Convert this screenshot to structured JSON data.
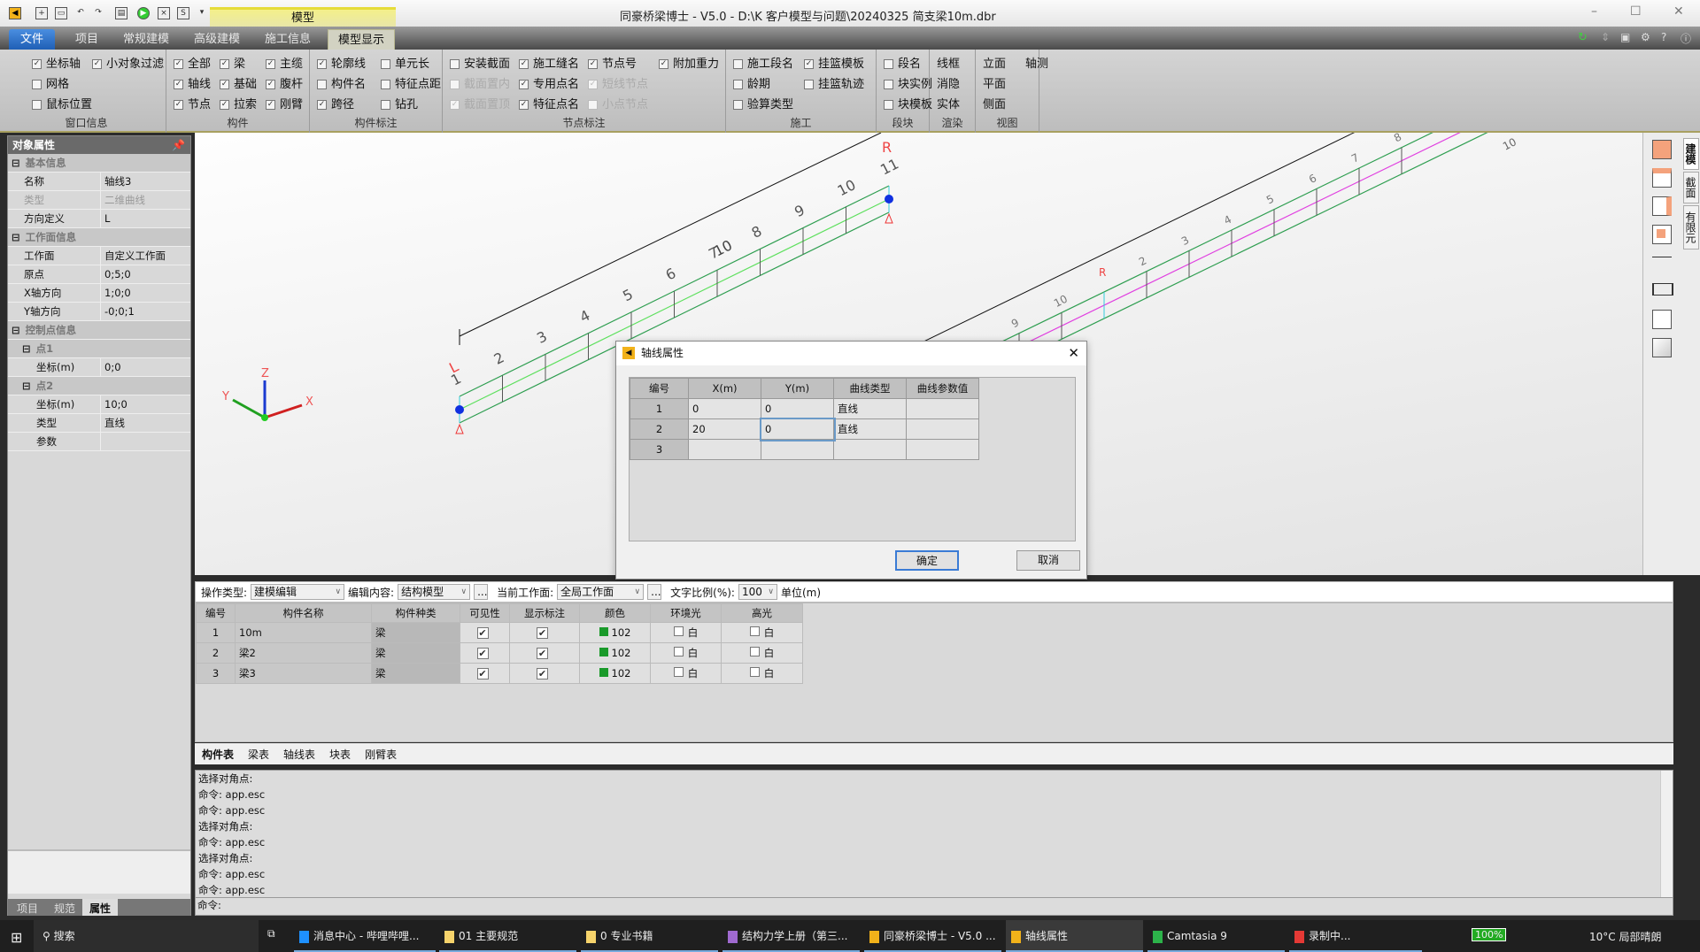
{
  "titlebar": {
    "title": "同豪桥梁博士 - V5.0 - D:\\K 客户模型与问题\\20240325 简支梁10m.dbr",
    "context_tab": "模型"
  },
  "tabs": [
    "文件",
    "项目",
    "常规建模",
    "高级建模",
    "施工信息",
    "模型显示"
  ],
  "ribbon": [
    {
      "label": "窗口信息",
      "cols": [
        [
          {
            "t": "坐标轴",
            "c": true
          },
          {
            "t": "网格",
            "c": false
          },
          {
            "t": "鼠标位置",
            "c": false
          }
        ],
        [
          {
            "t": "小对象过滤",
            "c": true
          }
        ]
      ]
    },
    {
      "label": "构件",
      "cols": [
        [
          {
            "t": "全部",
            "c": true
          },
          {
            "t": "轴线",
            "c": true
          },
          {
            "t": "节点",
            "c": true
          }
        ],
        [
          {
            "t": "梁",
            "c": true
          },
          {
            "t": "基础",
            "c": true
          },
          {
            "t": "拉索",
            "c": true
          }
        ],
        [
          {
            "t": "主缆",
            "c": true
          },
          {
            "t": "腹杆",
            "c": true
          },
          {
            "t": "刚臂",
            "c": true
          }
        ]
      ]
    },
    {
      "label": "构件标注",
      "cols": [
        [
          {
            "t": "轮廓线",
            "c": true
          },
          {
            "t": "构件名",
            "c": false
          },
          {
            "t": "跨径",
            "c": true
          }
        ],
        [
          {
            "t": "单元长",
            "c": false
          },
          {
            "t": "特征点距",
            "c": false
          },
          {
            "t": "钻孔",
            "c": false
          }
        ]
      ]
    },
    {
      "label": "节点标注",
      "cols": [
        [
          {
            "t": "安装截面",
            "c": false
          },
          {
            "t": "截面置内",
            "c": false,
            "d": true
          },
          {
            "t": "截面置顶",
            "c": true,
            "d": true
          }
        ],
        [
          {
            "t": "施工缝名",
            "c": true
          },
          {
            "t": "专用点名",
            "c": true
          },
          {
            "t": "特征点名",
            "c": true
          }
        ],
        [
          {
            "t": "节点号",
            "c": true
          },
          {
            "t": "短线节点",
            "c": true,
            "d": true
          },
          {
            "t": "小点节点",
            "c": false,
            "d": true
          }
        ],
        [
          {
            "t": "附加重力",
            "c": true
          }
        ]
      ]
    },
    {
      "label": "施工",
      "cols": [
        [
          {
            "t": "施工段名",
            "c": false
          },
          {
            "t": "龄期",
            "c": false
          },
          {
            "t": "验算类型",
            "c": false
          }
        ],
        [
          {
            "t": "挂篮模板",
            "c": true
          },
          {
            "t": "挂篮轨迹",
            "c": false
          }
        ]
      ]
    },
    {
      "label": "段块",
      "cols": [
        [
          {
            "t": "段名",
            "c": false
          },
          {
            "t": "块实例",
            "c": false
          },
          {
            "t": "块模板",
            "c": false
          }
        ]
      ]
    },
    {
      "label": "渲染",
      "cols": [
        [
          {
            "t": "线框"
          },
          {
            "t": "消隐"
          },
          {
            "t": "实体"
          }
        ]
      ]
    },
    {
      "label": "视图",
      "cols": [
        [
          {
            "t": "立面"
          },
          {
            "t": "平面"
          },
          {
            "t": "侧面"
          }
        ],
        [
          {
            "t": "轴测"
          }
        ]
      ]
    }
  ],
  "props": {
    "title": "对象属性",
    "rows": [
      {
        "k": "基本信息",
        "type": "sec"
      },
      {
        "k": "名称",
        "v": "轴线3"
      },
      {
        "k": "类型",
        "v": "二维曲线",
        "type": "dim"
      },
      {
        "k": "方向定义",
        "v": "L"
      },
      {
        "k": "工作面信息",
        "type": "sec"
      },
      {
        "k": "工作面",
        "v": "自定义工作面"
      },
      {
        "k": "原点",
        "v": "0;5;0"
      },
      {
        "k": "X轴方向",
        "v": "1;0;0"
      },
      {
        "k": "Y轴方向",
        "v": "-0;0;1"
      },
      {
        "k": "控制点信息",
        "type": "sec"
      },
      {
        "k": "点1",
        "type": "subsec"
      },
      {
        "k": "坐标(m)",
        "v": "0;0",
        "type": "sub"
      },
      {
        "k": "点2",
        "type": "subsec"
      },
      {
        "k": "坐标(m)",
        "v": "10;0",
        "type": "sub"
      },
      {
        "k": "类型",
        "v": "直线",
        "type": "sub"
      },
      {
        "k": "参数",
        "v": "",
        "type": "sub"
      }
    ],
    "bottom_tabs": [
      "项目",
      "规范",
      "属性"
    ]
  },
  "viewport": {
    "left_labels": [
      "1",
      "2",
      "3",
      "4",
      "5",
      "6",
      "7",
      "8",
      "9",
      "10",
      "11"
    ],
    "dim_label": "10",
    "L": "L",
    "R": "R",
    "right_labels": [
      "9",
      "10",
      "2",
      "3",
      "4",
      "5",
      "6",
      "7",
      "8"
    ],
    "right_dim_label": "10",
    "axes": [
      "X",
      "Y",
      "Z"
    ]
  },
  "right_tabs": [
    "建模",
    "截面",
    "有限元"
  ],
  "dialog": {
    "title": "轴线属性",
    "headers": [
      "编号",
      "X(m)",
      "Y(m)",
      "曲线类型",
      "曲线参数值"
    ],
    "rows": [
      [
        "1",
        "0",
        "0",
        "直线",
        ""
      ],
      [
        "2",
        "20",
        "0",
        "直线",
        ""
      ],
      [
        "3",
        "",
        "",
        "",
        ""
      ]
    ],
    "ok": "确定",
    "cancel": "取消"
  },
  "toolbar": {
    "op_label": "操作类型:",
    "op_value": "建模编辑",
    "content_label": "编辑内容:",
    "content_value": "结构模型",
    "plane_label": "当前工作面:",
    "plane_value": "全局工作面",
    "scale_label": "文字比例(%):",
    "scale_value": "100",
    "unit": "单位(m)",
    "more": "..."
  },
  "components": {
    "headers": [
      "编号",
      "构件名称",
      "构件种类",
      "可见性",
      "显示标注",
      "颜色",
      "环境光",
      "高光"
    ],
    "rows": [
      {
        "id": "1",
        "name": "10m",
        "kind": "梁",
        "visible": true,
        "label": true,
        "color": "102",
        "ambient": "白",
        "specular": "白"
      },
      {
        "id": "2",
        "name": "梁2",
        "kind": "梁",
        "visible": true,
        "label": true,
        "color": "102",
        "ambient": "白",
        "specular": "白"
      },
      {
        "id": "3",
        "name": "梁3",
        "kind": "梁",
        "visible": true,
        "label": true,
        "color": "102",
        "ambient": "白",
        "specular": "白"
      }
    ],
    "color_hex": "#1a9a2a"
  },
  "table_tabs": [
    "构件表",
    "梁表",
    "轴线表",
    "块表",
    "刚臂表"
  ],
  "command_log": [
    "选择对角点:",
    "命令: app.esc",
    "命令: app.esc",
    "选择对角点:",
    "命令: app.esc",
    "选择对角点:",
    "命令: app.esc",
    "命令: app.esc"
  ],
  "command_prompt": "命令:",
  "taskbar": {
    "search": "搜索",
    "items": [
      "消息中心 - 哔哩哔哩...",
      "01 主要规范",
      "0 专业书籍",
      "结构力学上册（第三...",
      "同豪桥梁博士 - V5.0 ...",
      "轴线属性",
      "Camtasia 9",
      "录制中..."
    ],
    "battery": "100%",
    "weather": "10°C 局部晴朗"
  }
}
